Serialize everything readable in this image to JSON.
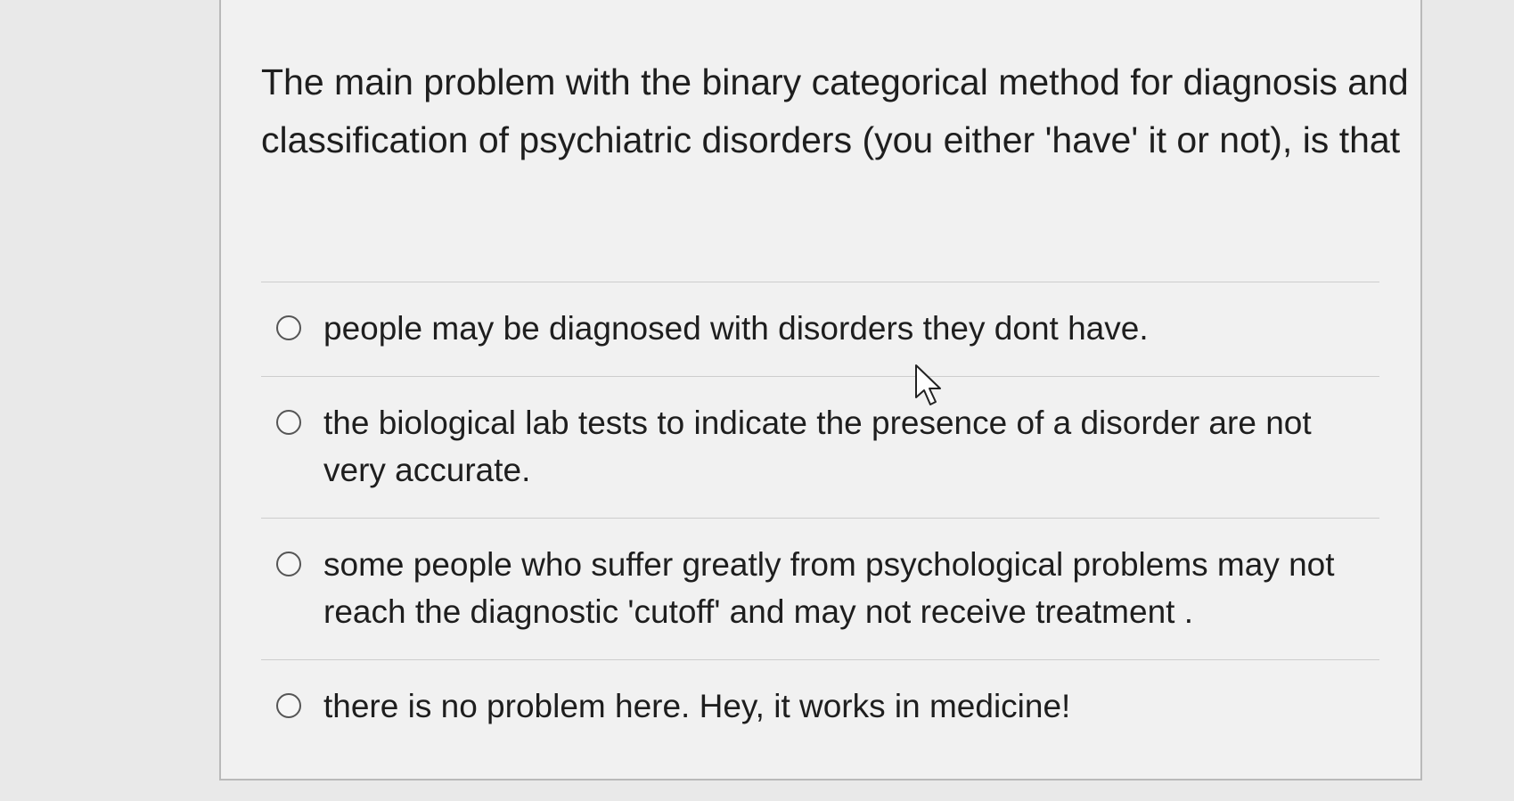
{
  "question": {
    "text": "The main problem with the binary categorical method for diagnosis and classification of psychiatric disorders (you either 'have' it or not), is that"
  },
  "options": [
    {
      "label": "people may be diagnosed with disorders they dont have.",
      "selected": false
    },
    {
      "label": "the biological lab tests to indicate the presence of a disorder are not very accurate.",
      "selected": false
    },
    {
      "label": "some people who suffer greatly from psychological problems may not reach the diagnostic 'cutoff' and may not receive treatment .",
      "selected": false
    },
    {
      "label": "there is no problem here. Hey, it works in medicine!",
      "selected": false
    }
  ],
  "cursor_icon": "mouse-pointer-icon"
}
